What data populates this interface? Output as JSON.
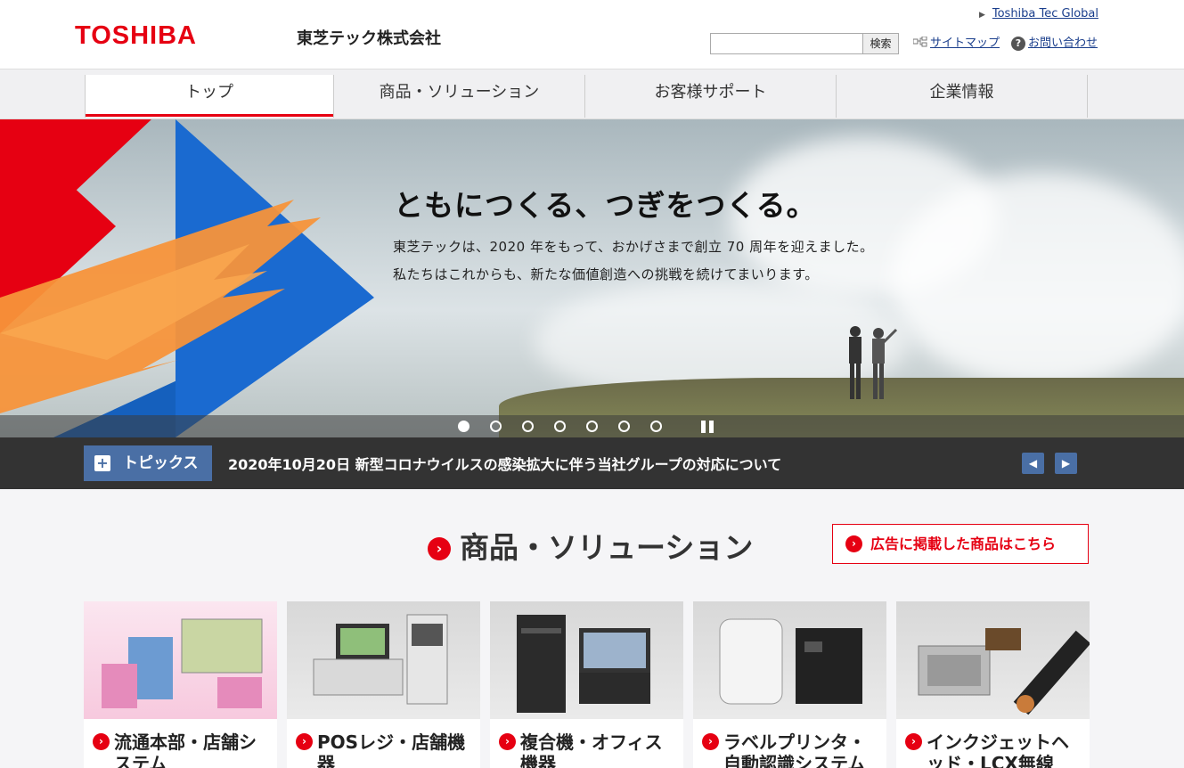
{
  "header": {
    "logo": "TOSHIBA",
    "company_name": "東芝テック株式会社",
    "global_link": "Toshiba Tec Global",
    "search": {
      "placeholder": "",
      "button_label": "検索"
    },
    "sitemap_label": "サイトマップ",
    "contact_label": "お問い合わせ",
    "brand_color": "#e60012"
  },
  "nav": {
    "items": [
      {
        "label": "トップ",
        "active": true
      },
      {
        "label": "商品・ソリューション",
        "active": false
      },
      {
        "label": "お客様サポート",
        "active": false
      },
      {
        "label": "企業情報",
        "active": false
      }
    ]
  },
  "hero": {
    "title": "ともにつくる、つぎをつくる。",
    "line1": "東芝テックは、2020 年をもって、おかげさまで創立 70 周年を迎えました。",
    "line2": "私たちはこれからも、新たな価値創造への挑戦を続けてまいります。",
    "slide_count": 7,
    "active_slide": 1
  },
  "topics": {
    "button_label": "トピックス",
    "headline": "2020年10月20日 新型コロナウイルスの感染拡大に伴う当社グループの対応について"
  },
  "products": {
    "section_title": "商品・ソリューション",
    "ad_button_label": "広告に掲載した商品はこちら",
    "cards": [
      {
        "label": "流通本部・店舗システム",
        "icon": "retail-system-image"
      },
      {
        "label": "POSレジ・店舗機器",
        "icon": "pos-register-image"
      },
      {
        "label": "複合機・オフィス機器",
        "icon": "mfp-office-image"
      },
      {
        "label": "ラベルプリンタ・自動認識システム",
        "icon": "label-printer-image"
      },
      {
        "label": "インクジェットヘッド・LCX無線",
        "icon": "inkjet-head-image"
      }
    ]
  }
}
